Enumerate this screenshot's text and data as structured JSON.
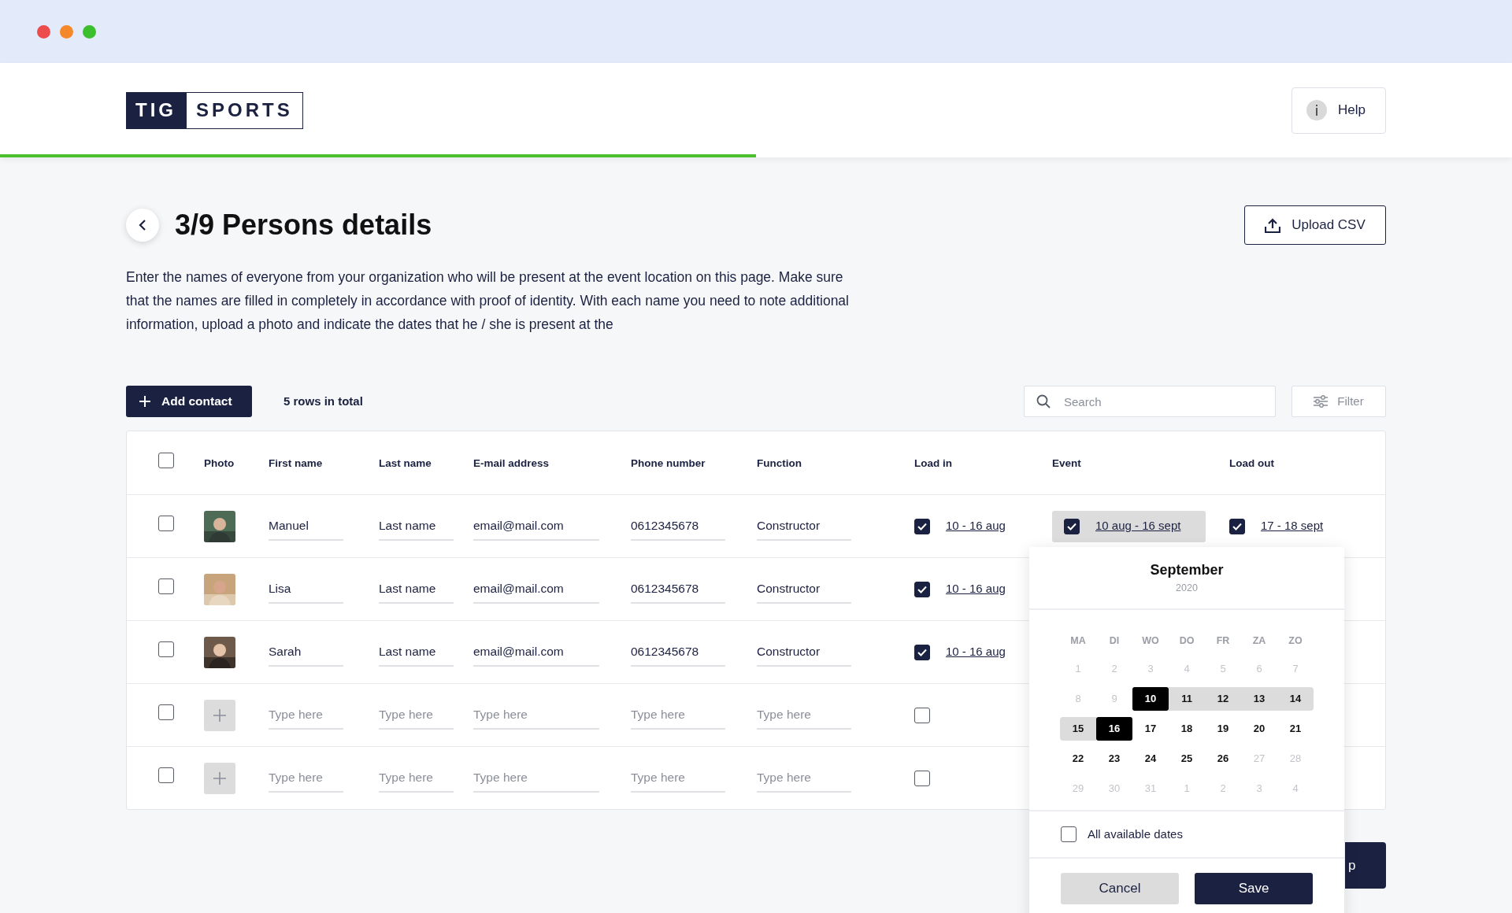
{
  "window": {
    "dots": [
      {
        "color": "#ed4c4c"
      },
      {
        "color": "#f5882a"
      },
      {
        "color": "#3cbf2d"
      }
    ]
  },
  "header": {
    "logo": [
      "TIG",
      "SPORTS"
    ],
    "help_button": "Help",
    "progress": {
      "level": 0.5
    }
  },
  "page": {
    "title": "3/9 Persons details",
    "description": "Enter the names of everyone from your organization who will be present at the event location on this page. Make sure that the names are filled in completely in accordance with proof of identity. With each name you need to note additional information, upload a photo and indicate the dates that he / she is present at the",
    "upload_button": "Upload CSV"
  },
  "toolbar": {
    "add_button": "Add contact",
    "row_count": "5 rows in total",
    "search": {
      "placeholder": "Search"
    },
    "filter_button": "Filter"
  },
  "table": {
    "all_checked": false,
    "columns": [
      "Photo",
      "First name",
      "Last name",
      "E-mail address",
      "Phone number",
      "Function",
      "Load in",
      "Event",
      "Load out"
    ],
    "rows": [
      {
        "checked": false,
        "fields": [
          {
            "value": "Manuel"
          },
          {
            "value": "Last name"
          },
          {
            "value": "email@mail.com"
          },
          {
            "value": "0612345678"
          },
          {
            "value": "Constructor"
          }
        ],
        "load_in": {
          "checked": true,
          "dates": "10 - 16 aug"
        },
        "event": {
          "checked": true,
          "dates": "10 aug - 16 sept",
          "selected": true
        },
        "load_out": {
          "checked": true,
          "dates": "17 - 18 sept"
        }
      },
      {
        "checked": false,
        "fields": [
          {
            "value": "Lisa"
          },
          {
            "value": "Last name"
          },
          {
            "value": "email@mail.com"
          },
          {
            "value": "0612345678"
          },
          {
            "value": "Constructor"
          }
        ],
        "load_in": {
          "checked": true,
          "dates": "10 - 16 aug"
        }
      },
      {
        "checked": false,
        "fields": [
          {
            "value": "Sarah"
          },
          {
            "value": "Last name"
          },
          {
            "value": "email@mail.com"
          },
          {
            "value": "0612345678"
          },
          {
            "value": "Constructor"
          }
        ],
        "load_in": {
          "checked": true,
          "dates": "10 - 16 aug"
        }
      },
      {
        "checked": false,
        "photo": {
          "kind": "add"
        },
        "fields": [
          {
            "placeholder": "Type here"
          },
          {
            "placeholder": "Type here"
          },
          {
            "placeholder": "Type here"
          },
          {
            "placeholder": "Type here"
          },
          {
            "placeholder": "Type here"
          }
        ],
        "load_in": {
          "checked": false
        }
      },
      {
        "checked": false,
        "photo": {
          "kind": "add"
        },
        "fields": [
          {
            "placeholder": "Type here"
          },
          {
            "placeholder": "Type here"
          },
          {
            "placeholder": "Type here"
          },
          {
            "placeholder": "Type here"
          },
          {
            "placeholder": "Type here"
          }
        ],
        "load_in": {
          "checked": false
        }
      }
    ]
  },
  "date_picker": {
    "month": "September",
    "year": "2020",
    "weekdays": [
      "MA",
      "DI",
      "WO",
      "DO",
      "FR",
      "ZA",
      "ZO"
    ],
    "days": [
      {
        "label": "1",
        "kind": "unavailable"
      },
      {
        "label": "2",
        "kind": "unavailable"
      },
      {
        "label": "3",
        "kind": "unavailable"
      },
      {
        "label": "4",
        "kind": "unavailable"
      },
      {
        "label": "5",
        "kind": "unavailable"
      },
      {
        "label": "6",
        "kind": "unavailable"
      },
      {
        "label": "7",
        "kind": "unavailable"
      },
      {
        "label": "8",
        "kind": "unavailable"
      },
      {
        "label": "9",
        "kind": "unavailable"
      },
      {
        "label": "10",
        "kind": "range_start"
      },
      {
        "label": "11",
        "kind": "in_range"
      },
      {
        "label": "12",
        "kind": "in_range"
      },
      {
        "label": "13",
        "kind": "in_range"
      },
      {
        "label": "14",
        "kind": "in_range"
      },
      {
        "label": "15",
        "kind": "in_range"
      },
      {
        "label": "16",
        "kind": "range_end"
      },
      {
        "label": "17",
        "kind": "available"
      },
      {
        "label": "18",
        "kind": "available"
      },
      {
        "label": "19",
        "kind": "available"
      },
      {
        "label": "20",
        "kind": "available"
      },
      {
        "label": "21",
        "kind": "available"
      },
      {
        "label": "22",
        "kind": "available"
      },
      {
        "label": "23",
        "kind": "available"
      },
      {
        "label": "24",
        "kind": "available"
      },
      {
        "label": "25",
        "kind": "available"
      },
      {
        "label": "26",
        "kind": "available"
      },
      {
        "label": "27",
        "kind": "unavailable"
      },
      {
        "label": "28",
        "kind": "unavailable"
      },
      {
        "label": "29",
        "kind": "unavailable"
      },
      {
        "label": "30",
        "kind": "unavailable"
      },
      {
        "label": "31",
        "kind": "unavailable"
      },
      {
        "label": "1",
        "kind": "unavailable"
      },
      {
        "label": "2",
        "kind": "unavailable"
      },
      {
        "label": "3",
        "kind": "unavailable"
      },
      {
        "label": "4",
        "kind": "unavailable"
      }
    ],
    "all_dates": {
      "label": "All available dates",
      "checked": false
    },
    "buttons": [
      {
        "label": "Cancel",
        "kind": "secondary"
      },
      {
        "label": "Save",
        "kind": "primary"
      }
    ]
  },
  "next_button": "p"
}
